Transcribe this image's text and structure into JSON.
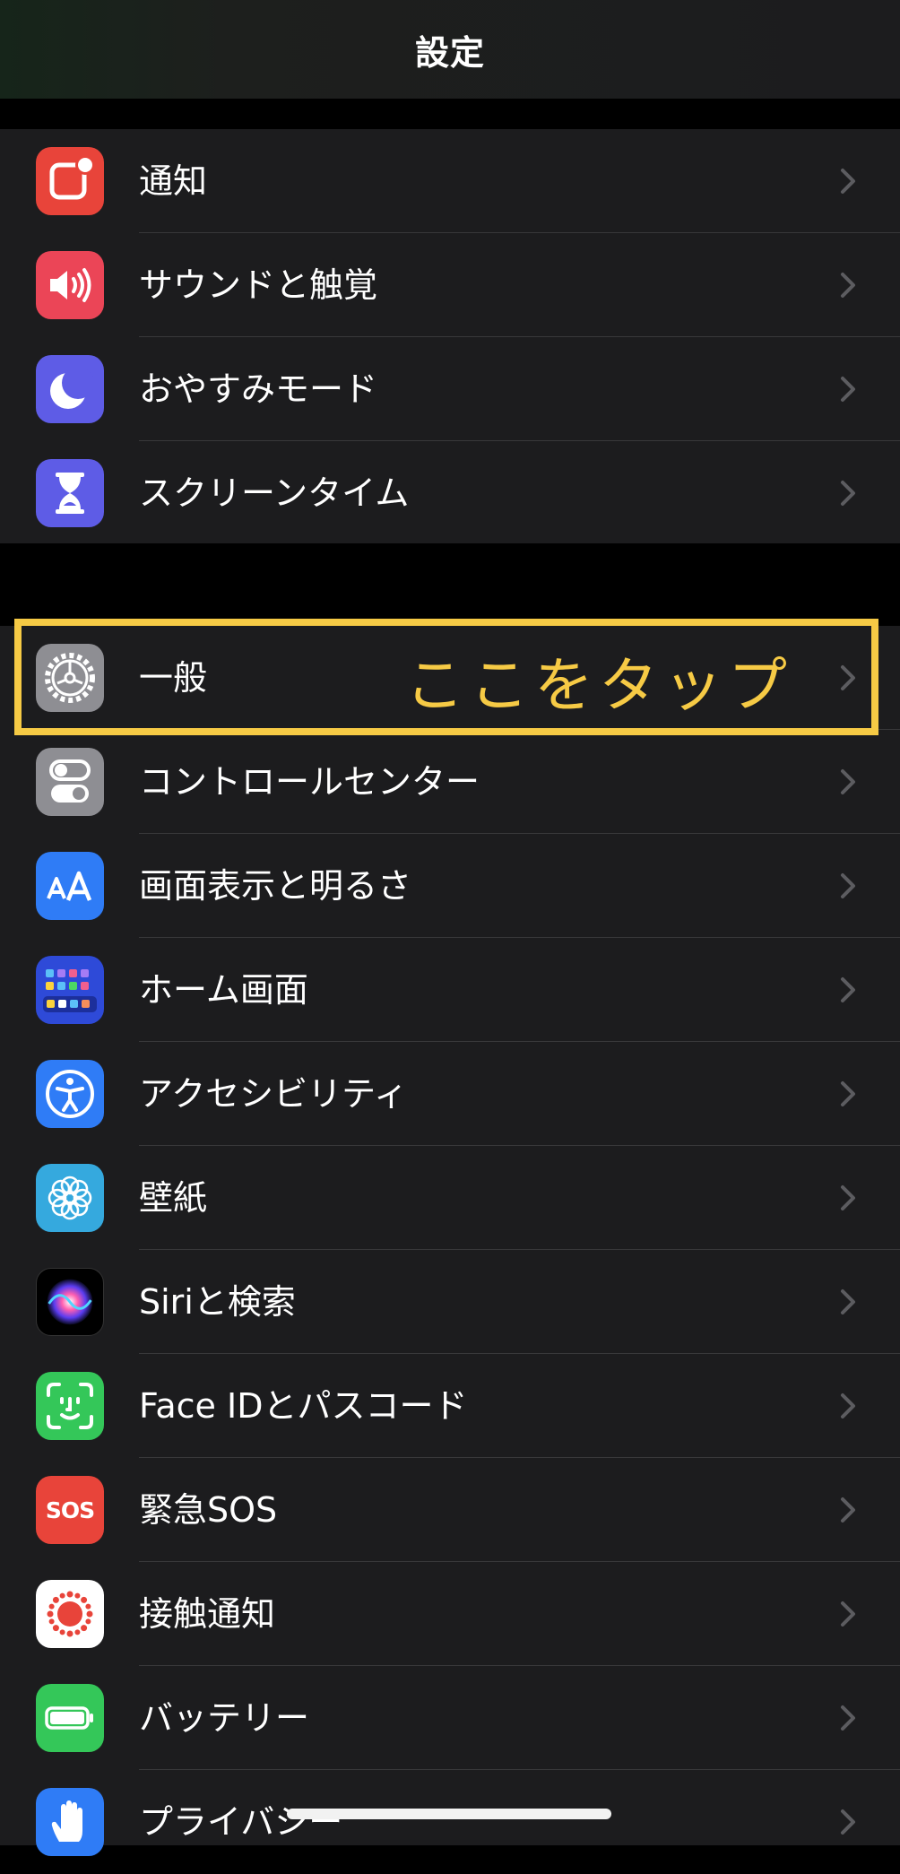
{
  "nav": {
    "title": "設定"
  },
  "callout": {
    "text": "ここをタップ",
    "color": "#f6ca45"
  },
  "group1": [
    {
      "label": "通知",
      "icon": "notification-icon",
      "color": "#e8443a"
    },
    {
      "label": "サウンドと触覚",
      "icon": "speaker-icon",
      "color": "#eb4557"
    },
    {
      "label": "おやすみモード",
      "icon": "moon-icon",
      "color": "#5e5ce6"
    },
    {
      "label": "スクリーンタイム",
      "icon": "hourglass-icon",
      "color": "#5e5ce6"
    }
  ],
  "group2": [
    {
      "label": "一般",
      "icon": "gear-icon",
      "color": "#8e8e93"
    },
    {
      "label": "コントロールセンター",
      "icon": "toggles-icon",
      "color": "#8e8e93"
    },
    {
      "label": "画面表示と明るさ",
      "icon": "text-size-icon",
      "color": "#2f7cf6"
    },
    {
      "label": "ホーム画面",
      "icon": "home-grid-icon",
      "color": "#2e4ad8"
    },
    {
      "label": "アクセシビリティ",
      "icon": "accessibility-icon",
      "color": "#2f7cf6"
    },
    {
      "label": "壁紙",
      "icon": "flower-icon",
      "color": "#35a9de"
    },
    {
      "label": "Siriと検索",
      "icon": "siri-icon",
      "color": "#1a1a2e"
    },
    {
      "label": "Face IDとパスコード",
      "icon": "faceid-icon",
      "color": "#34c759"
    },
    {
      "label": "緊急SOS",
      "icon": "sos-icon",
      "color": "#e8443a"
    },
    {
      "label": "接触通知",
      "icon": "exposure-icon",
      "color": "#ffffff"
    },
    {
      "label": "バッテリー",
      "icon": "battery-icon",
      "color": "#34c759"
    },
    {
      "label": "プライバシー",
      "icon": "hand-icon",
      "color": "#2f7cf6"
    }
  ]
}
